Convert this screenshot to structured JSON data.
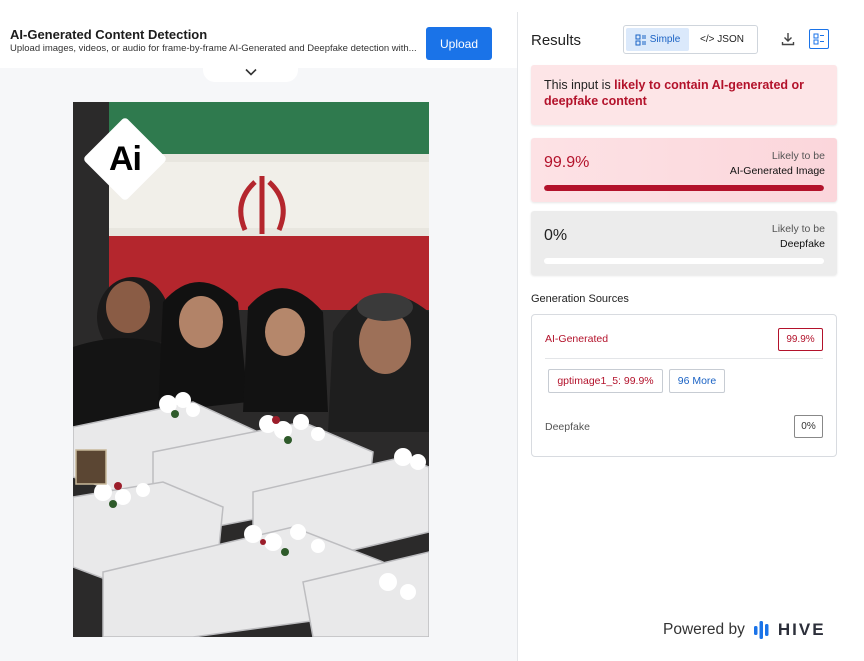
{
  "header": {
    "title": "AI-Generated Content Detection",
    "subtitle": "Upload images, videos, or audio for frame-by-frame AI-Generated and Deepfake detection with...",
    "upload_label": "Upload"
  },
  "preview": {
    "badge_text": "Ai"
  },
  "results": {
    "title": "Results",
    "view_toggle": {
      "simple_label": "Simple",
      "json_label": "</> JSON",
      "selected": "Simple"
    },
    "alert": {
      "prefix": "This input is ",
      "highlight": "likely to contain AI-generated or deepfake content"
    },
    "ai_card": {
      "percent_text": "99.9%",
      "percent_value": 99.9,
      "line1": "Likely to be",
      "line2": "AI-Generated Image"
    },
    "deepfake_card": {
      "percent_text": "0%",
      "percent_value": 0,
      "line1": "Likely to be",
      "line2": "Deepfake"
    },
    "sources": {
      "title": "Generation Sources",
      "ai_label": "AI-Generated",
      "ai_value": "99.9%",
      "model_chip": "gptimage1_5: 99.9%",
      "more_chip": "96 More",
      "deepfake_label": "Deepfake",
      "deepfake_value": "0%"
    }
  },
  "footer": {
    "powered_by": "Powered by",
    "brand": "HIVE"
  },
  "colors": {
    "accent": "#1a73e8",
    "danger": "#b3122b",
    "alert_bg": "#fde5e7"
  }
}
